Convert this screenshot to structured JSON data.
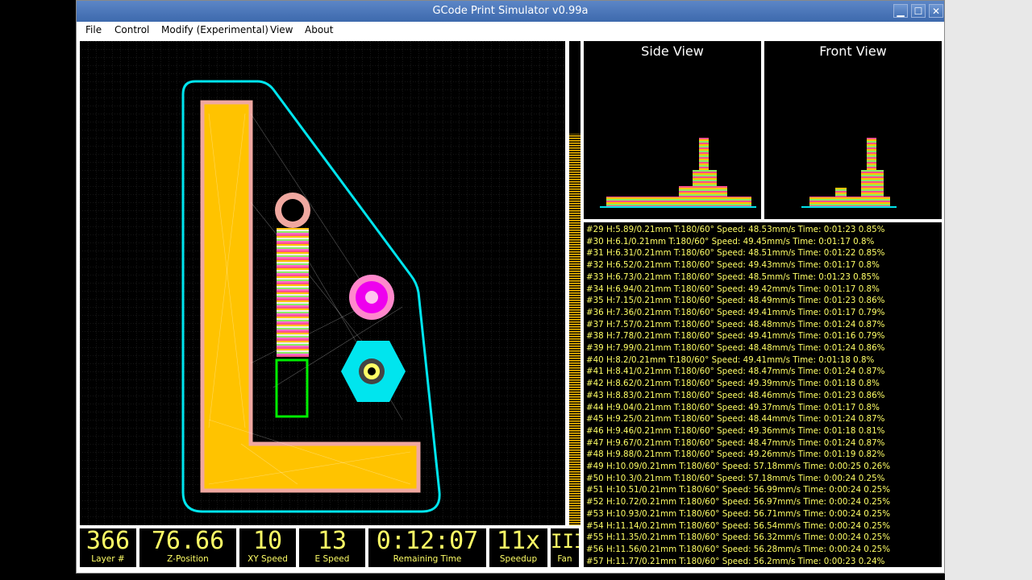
{
  "window": {
    "title": "GCode Print Simulator v0.99a",
    "buttons": {
      "minimize": "▁",
      "maximize": "☐",
      "close": "✕"
    }
  },
  "menu": [
    "File",
    "Control",
    "Modify (Experimental)",
    "View",
    "About"
  ],
  "views": {
    "side": "Side View",
    "front": "Front View"
  },
  "log": [
    "#29 H:5.89/0.21mm T:180/60° Speed: 48.53mm/s Time: 0:01:23  0.85%",
    "#30 H:6.1/0.21mm T:180/60° Speed: 49.45mm/s Time: 0:01:17  0.8%",
    "#31 H:6.31/0.21mm T:180/60° Speed: 48.51mm/s Time: 0:01:22  0.85%",
    "#32 H:6.52/0.21mm T:180/60° Speed: 49.43mm/s Time: 0:01:17  0.8%",
    "#33 H:6.73/0.21mm T:180/60° Speed: 48.5mm/s Time: 0:01:23  0.85%",
    "#34 H:6.94/0.21mm T:180/60° Speed: 49.42mm/s Time: 0:01:17  0.8%",
    "#35 H:7.15/0.21mm T:180/60° Speed: 48.49mm/s Time: 0:01:23  0.86%",
    "#36 H:7.36/0.21mm T:180/60° Speed: 49.41mm/s Time: 0:01:17  0.79%",
    "#37 H:7.57/0.21mm T:180/60° Speed: 48.48mm/s Time: 0:01:24  0.87%",
    "#38 H:7.78/0.21mm T:180/60° Speed: 49.41mm/s Time: 0:01:16  0.79%",
    "#39 H:7.99/0.21mm T:180/60° Speed: 48.48mm/s Time: 0:01:24  0.86%",
    "#40 H:8.2/0.21mm T:180/60° Speed: 49.41mm/s Time: 0:01:18  0.8%",
    "#41 H:8.41/0.21mm T:180/60° Speed: 48.47mm/s Time: 0:01:24  0.87%",
    "#42 H:8.62/0.21mm T:180/60° Speed: 49.39mm/s Time: 0:01:18  0.8%",
    "#43 H:8.83/0.21mm T:180/60° Speed: 48.46mm/s Time: 0:01:23  0.86%",
    "#44 H:9.04/0.21mm T:180/60° Speed: 49.37mm/s Time: 0:01:17  0.8%",
    "#45 H:9.25/0.21mm T:180/60° Speed: 48.44mm/s Time: 0:01:24  0.87%",
    "#46 H:9.46/0.21mm T:180/60° Speed: 49.36mm/s Time: 0:01:18  0.81%",
    "#47 H:9.67/0.21mm T:180/60° Speed: 48.47mm/s Time: 0:01:24  0.87%",
    "#48 H:9.88/0.21mm T:180/60° Speed: 49.26mm/s Time: 0:01:19  0.82%",
    "#49 H:10.09/0.21mm T:180/60° Speed: 57.18mm/s Time: 0:00:25  0.26%",
    "#50 H:10.3/0.21mm T:180/60° Speed: 57.18mm/s Time: 0:00:24  0.25%",
    "#51 H:10.51/0.21mm T:180/60° Speed: 56.99mm/s Time: 0:00:24  0.25%",
    "#52 H:10.72/0.21mm T:180/60° Speed: 56.97mm/s Time: 0:00:24  0.25%",
    "#53 H:10.93/0.21mm T:180/60° Speed: 56.71mm/s Time: 0:00:24  0.25%",
    "#54 H:11.14/0.21mm T:180/60° Speed: 56.54mm/s Time: 0:00:24  0.25%",
    "#55 H:11.35/0.21mm T:180/60° Speed: 56.32mm/s Time: 0:00:24  0.25%",
    "#56 H:11.56/0.21mm T:180/60° Speed: 56.28mm/s Time: 0:00:24  0.25%",
    "#57 H:11.77/0.21mm T:180/60° Speed: 56.2mm/s Time: 0:00:23  0.24%"
  ],
  "status": {
    "layer": {
      "value": "366",
      "label": "Layer #"
    },
    "z": {
      "value": "76.66",
      "label": "Z-Position"
    },
    "xy_speed": {
      "value": "10",
      "label": "XY Speed"
    },
    "e_speed": {
      "value": "13",
      "label": "E Speed"
    },
    "remaining": {
      "value": "0:12:07",
      "label": "Remaining Time"
    },
    "speedup": {
      "value": "11x",
      "label": "Speedup"
    },
    "fan": {
      "value": "IIII",
      "label": "Fan"
    }
  },
  "colors": {
    "accent_text": "#ffff66",
    "titlebar": "#4a76b8",
    "outline": "#00e5ee",
    "infill": "#ffc300",
    "perimeter": "#f0a8a0"
  }
}
